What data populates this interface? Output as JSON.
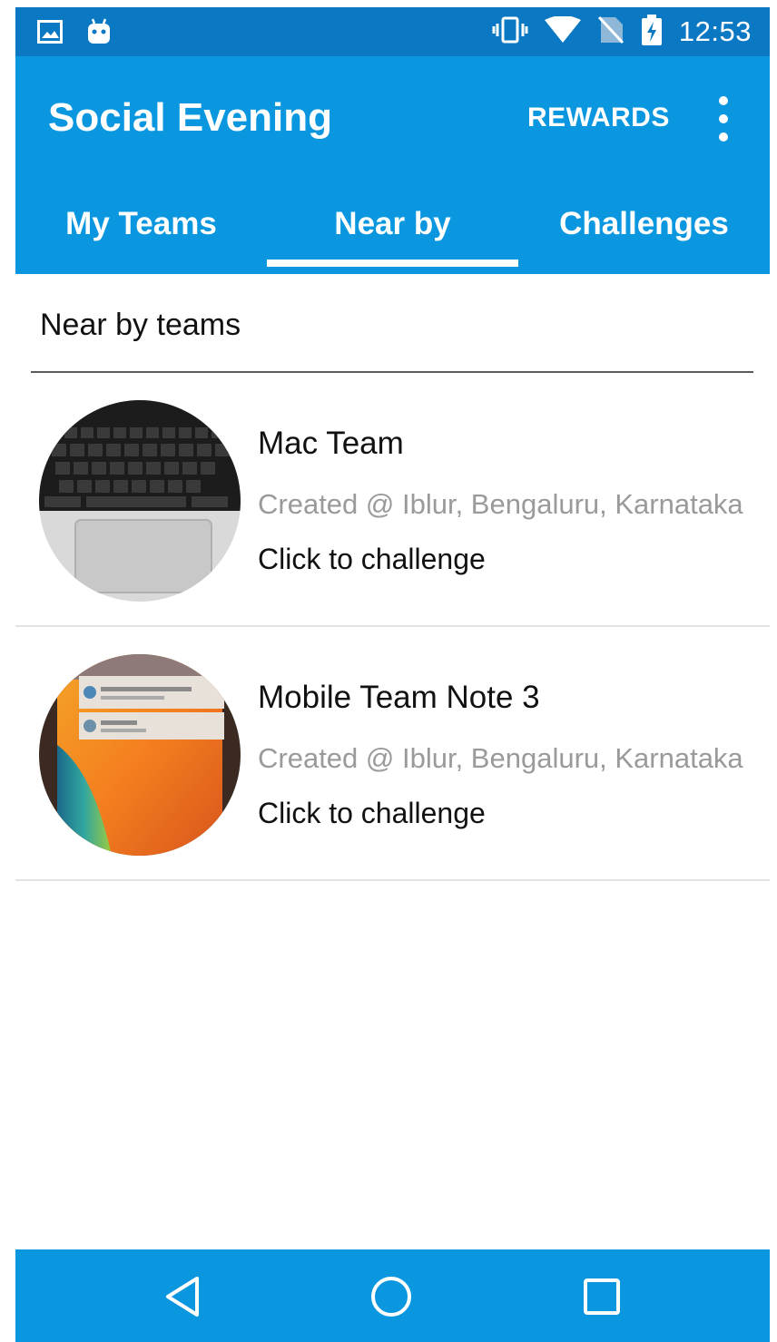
{
  "status_bar": {
    "time": "12:53",
    "left_icons": [
      "image-icon",
      "android-icon"
    ],
    "right_icons": [
      "vibrate-icon",
      "wifi-icon",
      "no-sim-icon",
      "battery-charging-icon"
    ]
  },
  "app_bar": {
    "title": "Social Evening",
    "rewards_label": "REWARDS",
    "overflow_icon": "more-vert-icon"
  },
  "tabs": [
    {
      "label": "My Teams",
      "active": false
    },
    {
      "label": "Near by",
      "active": true
    },
    {
      "label": "Challenges",
      "active": false
    }
  ],
  "section": {
    "title": "Near by teams"
  },
  "teams": [
    {
      "name": "Mac Team",
      "location": "Created @ Iblur, Bengaluru, Karnataka",
      "cta": "Click to challenge",
      "avatar": "laptop-keyboard-photo"
    },
    {
      "name": "Mobile Team Note 3",
      "location": "Created @ Iblur, Bengaluru, Karnataka",
      "cta": "Click to challenge",
      "avatar": "phone-screen-photo"
    }
  ],
  "nav_bar": {
    "buttons": [
      "back-icon",
      "home-icon",
      "recents-icon"
    ]
  },
  "colors": {
    "status_bar": "#0a78c2",
    "primary": "#0a97e0",
    "text": "#111111",
    "secondary_text": "#9a9a9a"
  }
}
